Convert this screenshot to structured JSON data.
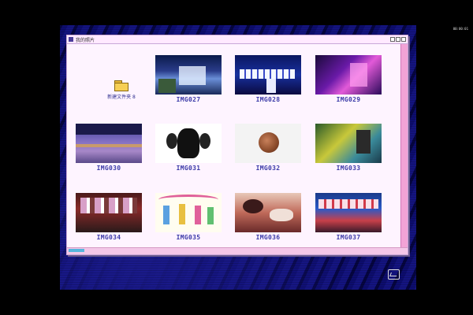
{
  "window": {
    "title": "我的照片"
  },
  "folder": {
    "label": "新建文件夹 8",
    "icon": "folder-icon"
  },
  "images": [
    {
      "name": "IMG027",
      "icon": "photo-thumbnail"
    },
    {
      "name": "IMG028",
      "icon": "photo-thumbnail"
    },
    {
      "name": "IMG029",
      "icon": "photo-thumbnail"
    },
    {
      "name": "IMG030",
      "icon": "photo-thumbnail"
    },
    {
      "name": "IMG031",
      "icon": "photo-thumbnail"
    },
    {
      "name": "IMG032",
      "icon": "photo-thumbnail"
    },
    {
      "name": "IMG033",
      "icon": "photo-thumbnail"
    },
    {
      "name": "IMG034",
      "icon": "photo-thumbnail"
    },
    {
      "name": "IMG035",
      "icon": "photo-thumbnail"
    },
    {
      "name": "IMG036",
      "icon": "photo-thumbnail"
    },
    {
      "name": "IMG037",
      "icon": "photo-thumbnail"
    }
  ],
  "corner_label": "00:00:01",
  "colors": {
    "accent": "#3b3aa8",
    "window_bg": "#ffe9ff",
    "scrollbar": "#f2a3d6"
  }
}
